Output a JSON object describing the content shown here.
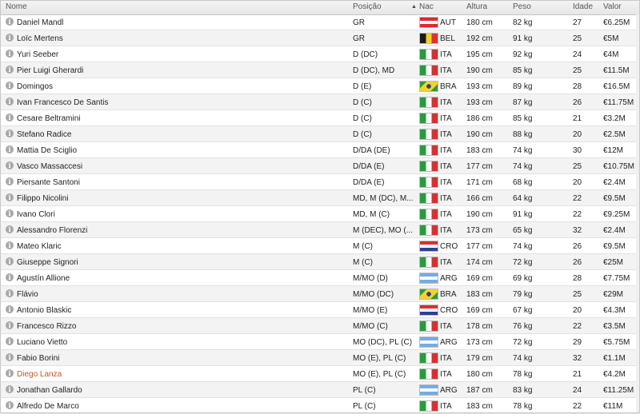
{
  "columns": {
    "name": "Nome",
    "position": "Posição",
    "nationality": "Nac",
    "height": "Altura",
    "weight": "Peso",
    "age": "Idade",
    "value": "Valor"
  },
  "flag_colors": {
    "AUT": [
      "#e02a2a",
      "#ffffff",
      "#e02a2a"
    ],
    "BEL": [
      "#1a1a1a",
      "#f5d01e",
      "#e03030"
    ],
    "ITA": [
      "#2a9a40",
      "#ffffff",
      "#d83030"
    ],
    "BRA": [
      "#2d9c3a",
      "#f2d32b",
      "#2b3f8f"
    ],
    "CRO": [
      "#d73030",
      "#ffffff",
      "#2b3f9a"
    ],
    "ARG": [
      "#74acdf",
      "#ffffff",
      "#74acdf"
    ]
  },
  "players": [
    {
      "name": "Daniel Mandl",
      "position": "GR",
      "nat": "AUT",
      "height": "180 cm",
      "weight": "82 kg",
      "age": "27",
      "value": "€6.25M"
    },
    {
      "name": "Loïc Mertens",
      "position": "GR",
      "nat": "BEL",
      "height": "192 cm",
      "weight": "91 kg",
      "age": "25",
      "value": "€5M"
    },
    {
      "name": "Yuri Seeber",
      "position": "D (DC)",
      "nat": "ITA",
      "height": "195 cm",
      "weight": "92 kg",
      "age": "24",
      "value": "€4M"
    },
    {
      "name": "Pier Luigi Gherardi",
      "position": "D (DC), MD",
      "nat": "ITA",
      "height": "190 cm",
      "weight": "85 kg",
      "age": "25",
      "value": "€11.5M"
    },
    {
      "name": "Domingos",
      "position": "D (E)",
      "nat": "BRA",
      "height": "193 cm",
      "weight": "89 kg",
      "age": "28",
      "value": "€16.5M"
    },
    {
      "name": "Ivan Francesco De Santis",
      "position": "D (C)",
      "nat": "ITA",
      "height": "193 cm",
      "weight": "87 kg",
      "age": "26",
      "value": "€11.75M"
    },
    {
      "name": "Cesare Beltramini",
      "position": "D (C)",
      "nat": "ITA",
      "height": "186 cm",
      "weight": "85 kg",
      "age": "21",
      "value": "€3.2M"
    },
    {
      "name": "Stefano Radice",
      "position": "D (C)",
      "nat": "ITA",
      "height": "190 cm",
      "weight": "88 kg",
      "age": "20",
      "value": "€2.5M"
    },
    {
      "name": "Mattia De Sciglio",
      "position": "D/DA (DE)",
      "nat": "ITA",
      "height": "183 cm",
      "weight": "74 kg",
      "age": "30",
      "value": "€12M"
    },
    {
      "name": "Vasco Massaccesi",
      "position": "D/DA (E)",
      "nat": "ITA",
      "height": "177 cm",
      "weight": "74 kg",
      "age": "25",
      "value": "€10.75M"
    },
    {
      "name": "Piersante Santoni",
      "position": "D/DA (E)",
      "nat": "ITA",
      "height": "171 cm",
      "weight": "68 kg",
      "age": "20",
      "value": "€2.4M"
    },
    {
      "name": "Filippo Nicolini",
      "position": "MD, M (DC), M...",
      "nat": "ITA",
      "height": "166 cm",
      "weight": "64 kg",
      "age": "22",
      "value": "€9.5M"
    },
    {
      "name": "Ivano Clori",
      "position": "MD, M (C)",
      "nat": "ITA",
      "height": "190 cm",
      "weight": "91 kg",
      "age": "22",
      "value": "€9.25M"
    },
    {
      "name": "Alessandro Florenzi",
      "position": "M (DEC), MO (...",
      "nat": "ITA",
      "height": "173 cm",
      "weight": "65 kg",
      "age": "32",
      "value": "€2.4M"
    },
    {
      "name": "Mateo Klaric",
      "position": "M (C)",
      "nat": "CRO",
      "height": "177 cm",
      "weight": "74 kg",
      "age": "26",
      "value": "€9.5M"
    },
    {
      "name": "Giuseppe Signori",
      "position": "M (C)",
      "nat": "ITA",
      "height": "174 cm",
      "weight": "72 kg",
      "age": "26",
      "value": "€25M"
    },
    {
      "name": "Agustín Allione",
      "position": "M/MO (D)",
      "nat": "ARG",
      "height": "169 cm",
      "weight": "69 kg",
      "age": "28",
      "value": "€7.75M"
    },
    {
      "name": "Flávio",
      "position": "M/MO (DC)",
      "nat": "BRA",
      "height": "183 cm",
      "weight": "79 kg",
      "age": "25",
      "value": "€29M"
    },
    {
      "name": "Antonio Blaskic",
      "position": "M/MO (E)",
      "nat": "CRO",
      "height": "169 cm",
      "weight": "67 kg",
      "age": "20",
      "value": "€4.3M"
    },
    {
      "name": "Francesco Rizzo",
      "position": "M/MO (C)",
      "nat": "ITA",
      "height": "178 cm",
      "weight": "76 kg",
      "age": "22",
      "value": "€3.5M"
    },
    {
      "name": "Luciano Vietto",
      "position": "MO (DC), PL (C)",
      "nat": "ARG",
      "height": "173 cm",
      "weight": "72 kg",
      "age": "29",
      "value": "€5.75M"
    },
    {
      "name": "Fabio Borini",
      "position": "MO (E), PL (C)",
      "nat": "ITA",
      "height": "179 cm",
      "weight": "74 kg",
      "age": "32",
      "value": "€1.1M"
    },
    {
      "name": "Diego Lanza",
      "position": "MO (E), PL (C)",
      "nat": "ITA",
      "height": "180 cm",
      "weight": "78 kg",
      "age": "21",
      "value": "€4.2M",
      "highlight": true
    },
    {
      "name": "Jonathan Gallardo",
      "position": "PL (C)",
      "nat": "ARG",
      "height": "187 cm",
      "weight": "83 kg",
      "age": "24",
      "value": "€11.25M"
    },
    {
      "name": "Alfredo De Marco",
      "position": "PL (C)",
      "nat": "ITA",
      "height": "183 cm",
      "weight": "78 kg",
      "age": "22",
      "value": "€11M"
    }
  ]
}
